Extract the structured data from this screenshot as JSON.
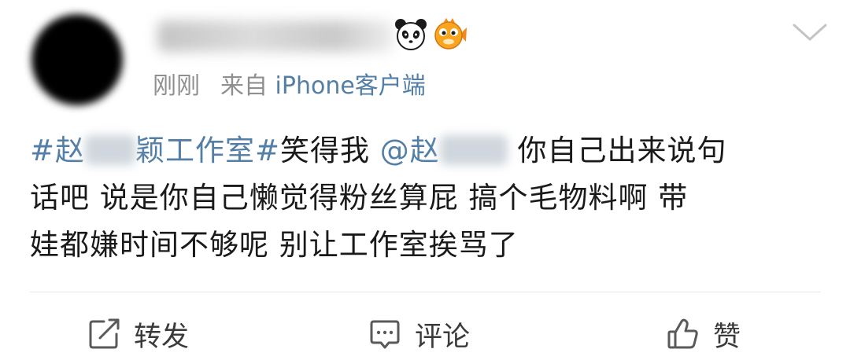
{
  "post": {
    "time": "刚刚",
    "source_prefix": "来自",
    "source_client": "iPhone客户端",
    "content": {
      "topic_start": "#赵",
      "topic_end": "颖工作室#",
      "text_1": "笑得我 ",
      "mention_start": "@赵",
      "text_2": " 你自己出来说句",
      "text_3": "话吧 说是你自己懒觉得粉丝算屁 搞个毛物料啊 带",
      "text_4": "娃都嫌时间不够呢 别让工作室挨骂了"
    }
  },
  "icons": {
    "avatar": "avatar",
    "badge_1": "panda-badge-icon",
    "badge_2": "pufferfish-badge-icon",
    "menu": "chevron-down-icon",
    "repost": "repost-icon",
    "comment": "comment-icon",
    "like": "thumbs-up-icon"
  },
  "actions": {
    "repost_label": "转发",
    "comment_label": "评论",
    "like_label": "赞"
  },
  "colors": {
    "link": "#537ea6",
    "meta": "#8f8f8f",
    "text": "#1a1a1a",
    "action_text": "#3a3a3a"
  }
}
